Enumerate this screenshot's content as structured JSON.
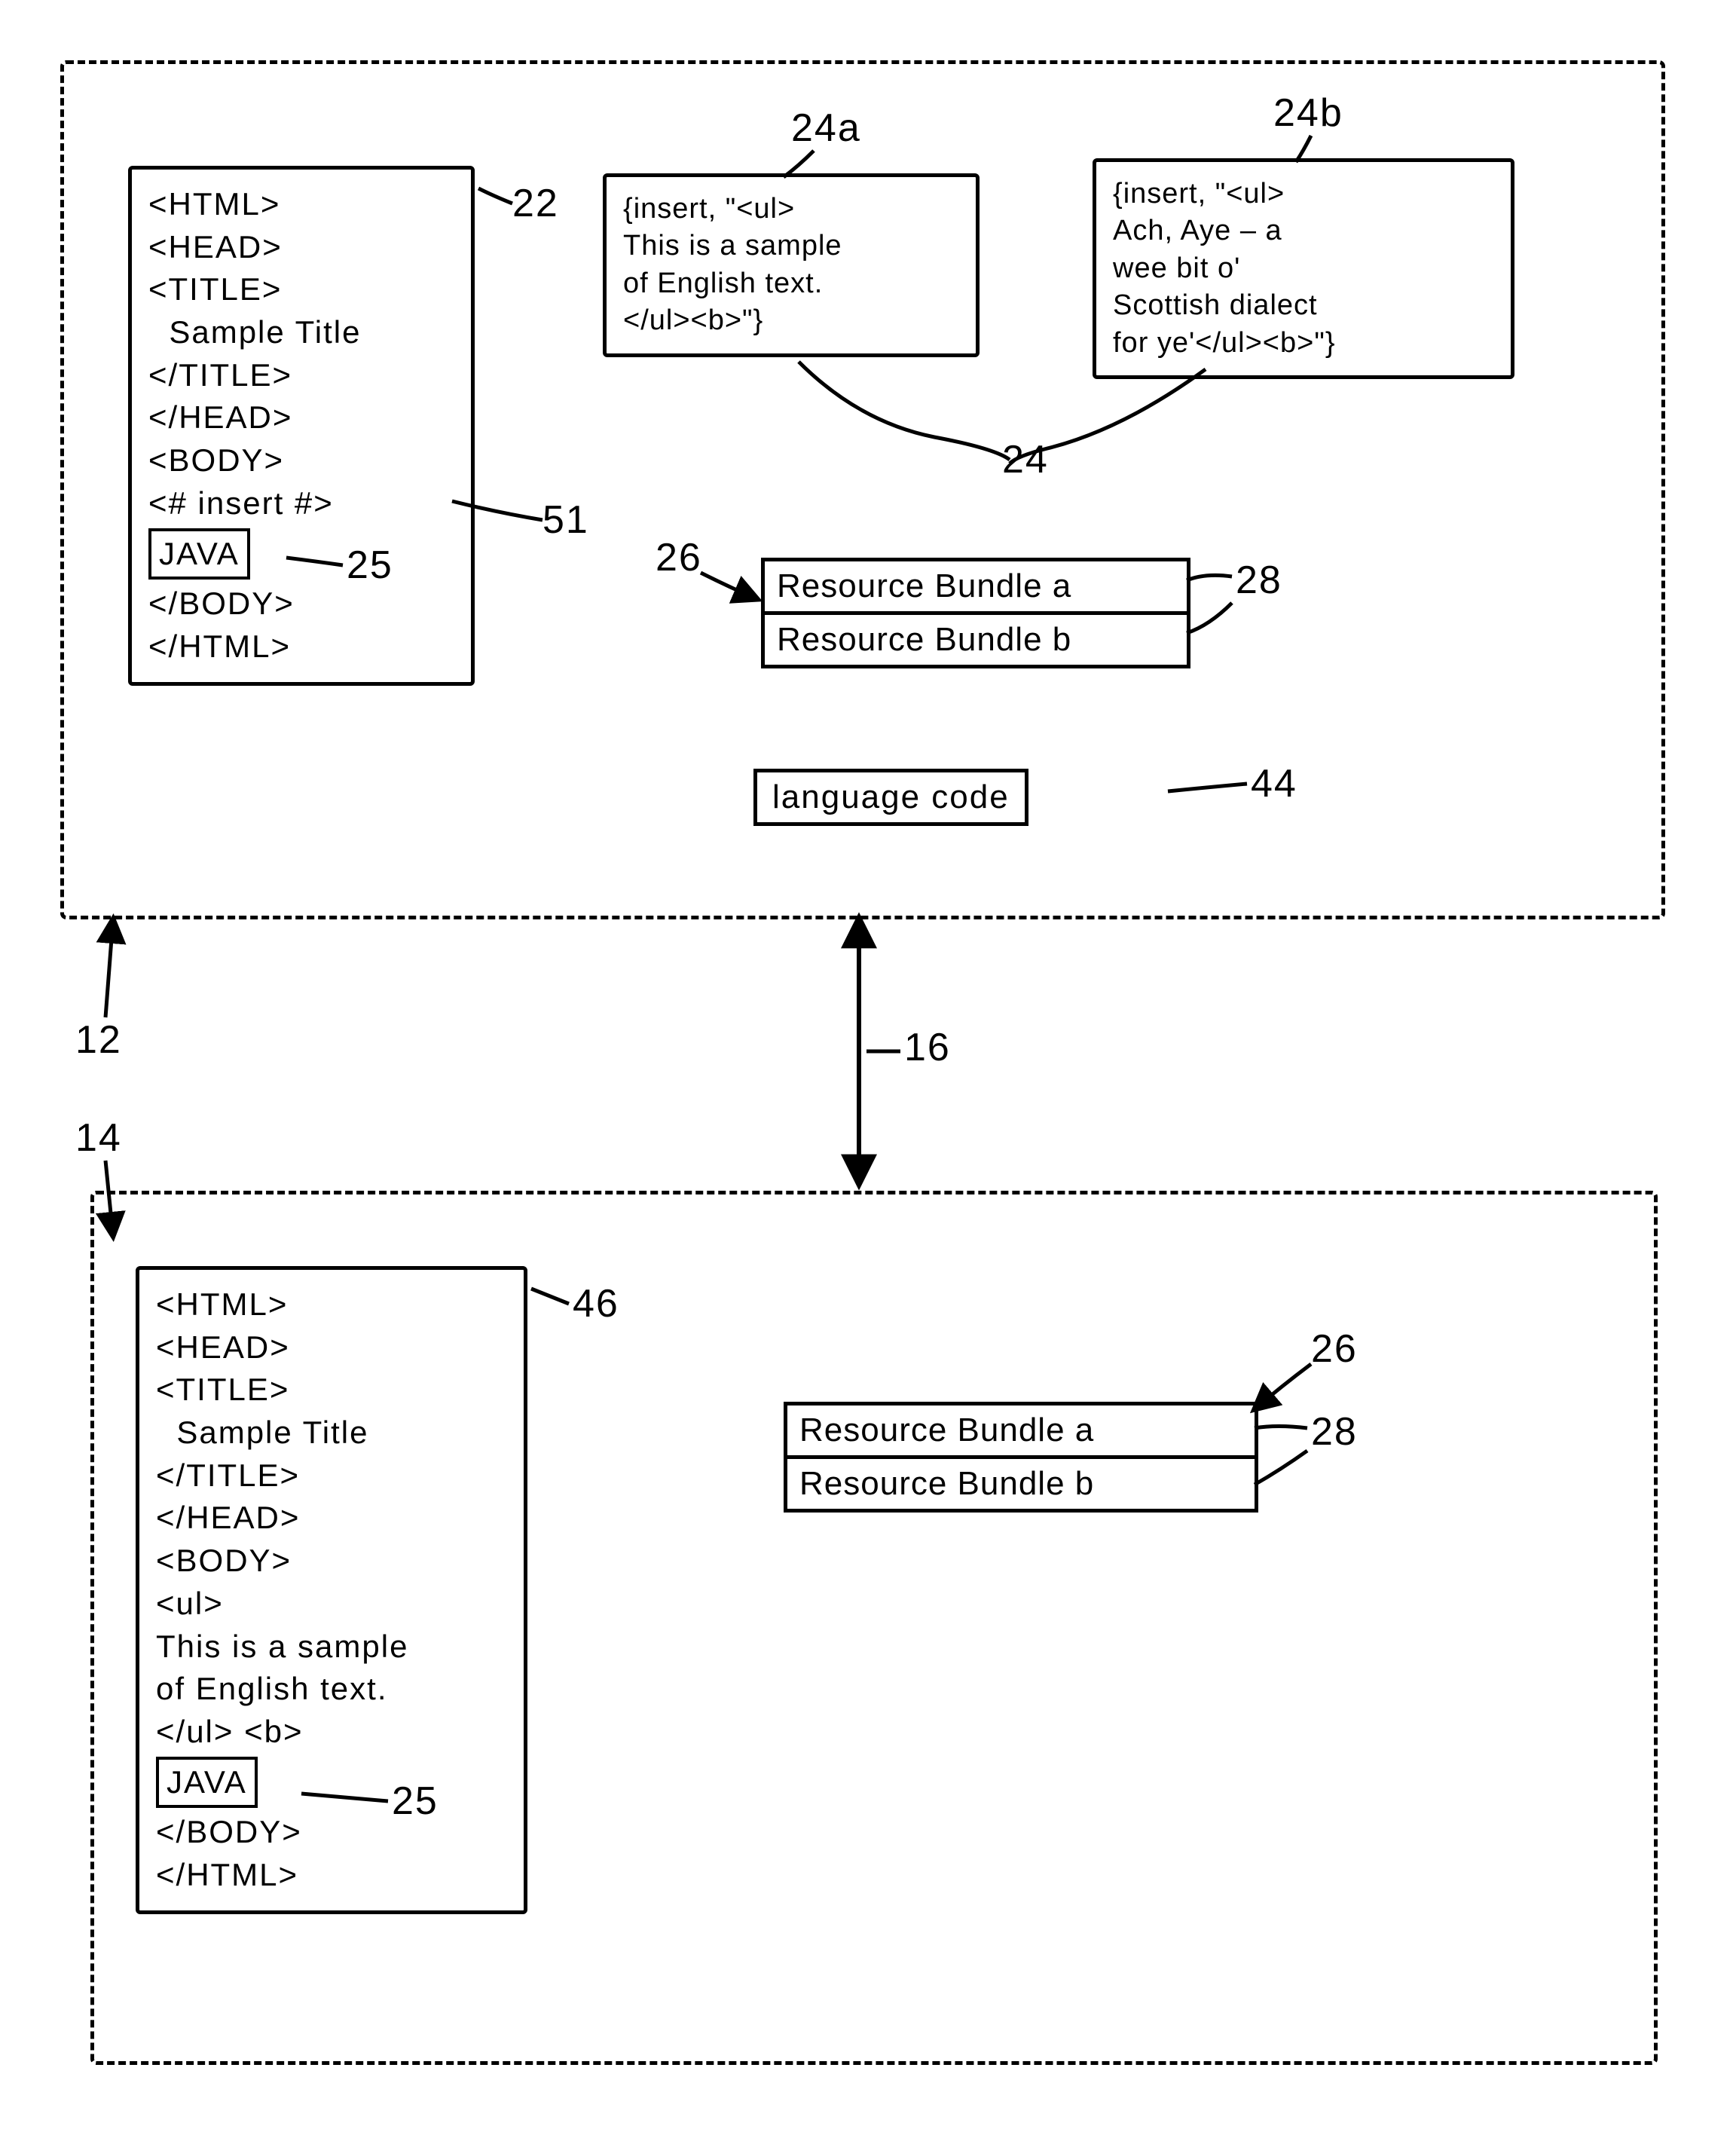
{
  "refs": {
    "r12": "12",
    "r14": "14",
    "r16": "16",
    "r22": "22",
    "r24": "24",
    "r24a": "24a",
    "r24b": "24b",
    "r25a": "25",
    "r25b": "25",
    "r26a": "26",
    "r26b": "26",
    "r28a": "28",
    "r28b": "28",
    "r44": "44",
    "r46": "46",
    "r51": "51"
  },
  "box22": {
    "l1": "<HTML>",
    "l2": "<HEAD>",
    "l3": "<TITLE>",
    "l4": "  Sample Title",
    "l5": "</TITLE>",
    "l6": "</HEAD>",
    "l7": "<BODY>",
    "l8": "<# insert #>",
    "java": "JAVA",
    "l10": "</BODY>",
    "l11": "</HTML>"
  },
  "box24a": {
    "l1": "{insert, \"<ul>",
    "l2": "This is a sample",
    "l3": "of English text.",
    "l4": "</ul><b>\"}"
  },
  "box24b": {
    "l1": "{insert, \"<ul>",
    "l2": "Ach, Aye – a",
    "l3": "wee bit o'",
    "l4": "Scottish dialect",
    "l5": "for ye'</ul><b>\"}"
  },
  "bundles_top": {
    "a": "Resource Bundle a",
    "b": "Resource Bundle b"
  },
  "lang": "language code",
  "box46": {
    "l1": "<HTML>",
    "l2": "<HEAD>",
    "l3": "<TITLE>",
    "l4": "  Sample Title",
    "l5": "</TITLE>",
    "l6": "</HEAD>",
    "l7": "<BODY>",
    "l8": "<ul>",
    "l9": "This is a sample",
    "l10": "of English text.",
    "l11": "</ul> <b>",
    "java": "JAVA",
    "l13": "</BODY>",
    "l14": "</HTML>"
  },
  "bundles_bot": {
    "a": "Resource Bundle a",
    "b": "Resource Bundle b"
  }
}
